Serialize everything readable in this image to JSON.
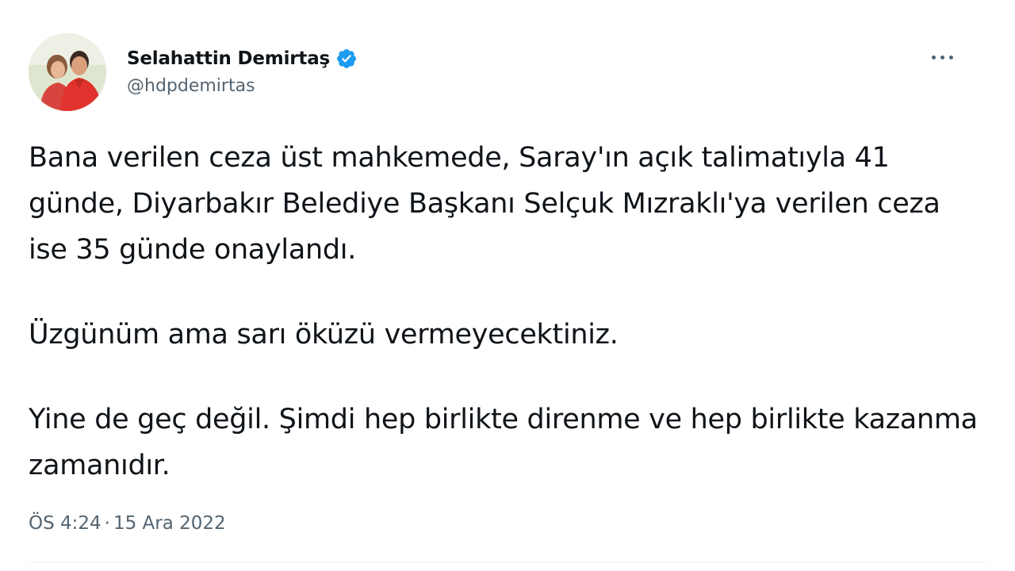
{
  "author": {
    "display_name": "Selahattin Demirtaş",
    "handle": "@hdpdemirtas",
    "avatar_icon": "profile-photo",
    "verified_icon": "verified-badge-icon",
    "verified_color": "#1d9bf0"
  },
  "tweet": {
    "paragraphs": [
      "Bana verilen ceza üst mahkemede, Saray'ın açık talimatıyla 41 günde, Diyarbakır Belediye Başkanı Selçuk Mızraklı'ya verilen ceza ise 35 günde onaylandı.",
      "Üzgünüm ama sarı öküzü vermeyecektiniz.",
      "Yine de geç değil. Şimdi hep birlikte direnme ve hep birlikte kazanma zamanıdır."
    ],
    "time": "ÖS 4:24",
    "separator": "·",
    "date": "15 Ara 2022"
  },
  "actions": {
    "more_icon": "more-dots-icon"
  },
  "colors": {
    "text_primary": "#0f1419",
    "text_secondary": "#536471",
    "background": "#ffffff"
  }
}
